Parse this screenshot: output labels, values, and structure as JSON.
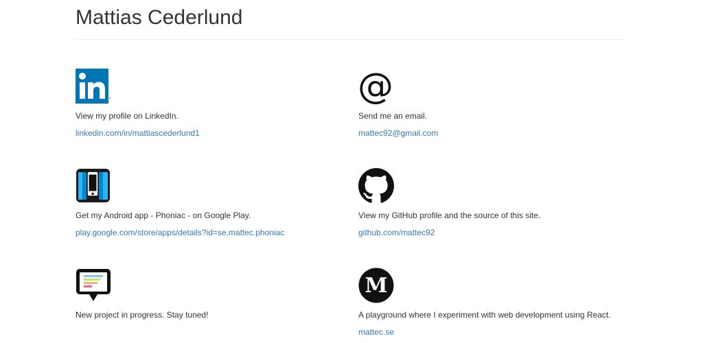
{
  "header": {
    "title": "Mattias Cederlund"
  },
  "colors": {
    "link": "#337ab7",
    "text": "#333333",
    "linkedin_blue": "#0077b5",
    "phoniac_blue": "#29b6f6"
  },
  "cards": {
    "linkedin": {
      "icon": "linkedin-icon",
      "description": "View my profile on LinkedIn.",
      "link_text": "linkedin.com/in/mattiascederlund1"
    },
    "email": {
      "icon": "at-sign-icon",
      "description": "Send me an email.",
      "link_text": "mattec92@gmail.com"
    },
    "phoniac": {
      "icon": "phoniac-app-icon",
      "description": "Get my Android app - Phoniac - on Google Play.",
      "link_text": "play.google.com/store/apps/details?id=se.mattec.phoniac"
    },
    "github": {
      "icon": "github-icon",
      "description": "View my GitHub profile and the source of this site.",
      "link_text": "github.com/mattec92"
    },
    "project": {
      "icon": "speech-bubble-icon",
      "description": "New project in progress. Stay tuned!"
    },
    "mattec": {
      "icon": "medium-m-icon",
      "description": "A playground where I experiment with web development using React.",
      "link_text": "mattec.se"
    }
  }
}
